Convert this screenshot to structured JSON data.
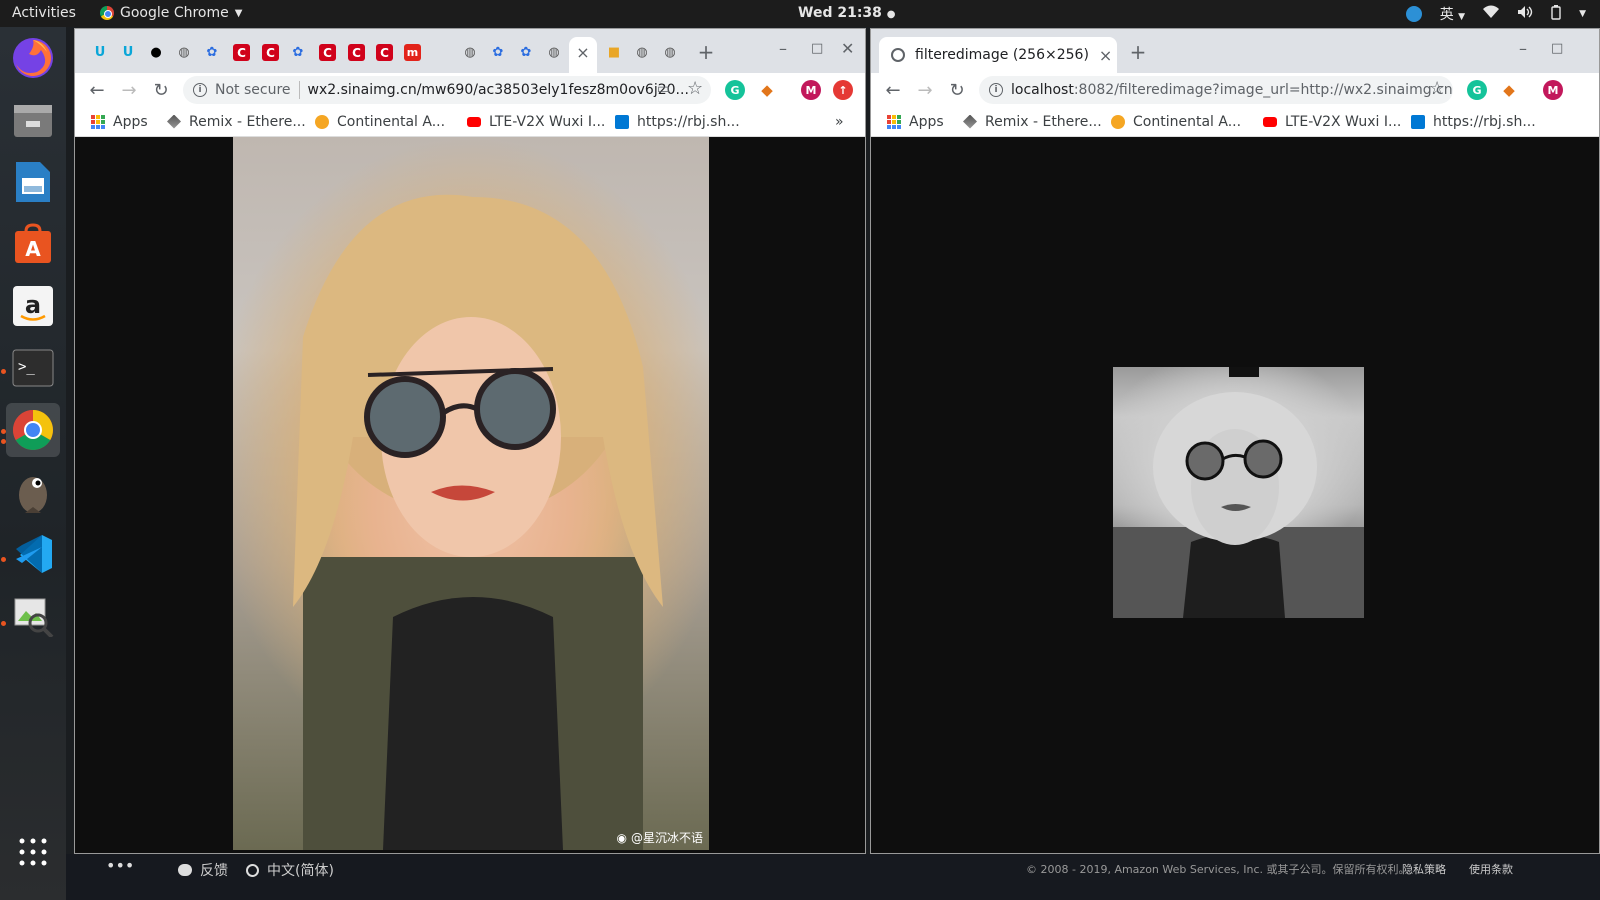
{
  "topbar": {
    "activities": "Activities",
    "app_name": "Google Chrome",
    "clock": "Wed 21:38",
    "input_method": "英"
  },
  "dock": {
    "items": [
      "firefox-icon",
      "files-icon",
      "writer-icon",
      "software-center-icon",
      "amazon-icon",
      "terminal-icon",
      "chrome-icon",
      "gimp-icon",
      "vscode-icon",
      "image-viewer-icon"
    ],
    "show_apps": "show-apps-icon"
  },
  "left_window": {
    "tab_close": "×",
    "new_tab": "+",
    "not_secure": "Not secure",
    "url": "wx2.sinaimg.cn/mw690/ac38503ely1fesz8m0ov6j20...",
    "bookmarks": [
      "Apps",
      "Remix - Ethere...",
      "Continental A...",
      "LTE-V2X Wuxi I...",
      "https://rbj.sh..."
    ],
    "more_bookmarks": "»",
    "watermark": "@星沉冰不语"
  },
  "right_window": {
    "tab_title": "filteredimage (256×256)",
    "tab_close": "×",
    "new_tab": "+",
    "url_host": "localhost",
    "url_rest": ":8082/filteredimage?image_url=http://wx2.sinaimg.cn...",
    "bookmarks": [
      "Apps",
      "Remix - Ethere...",
      "Continental A...",
      "LTE-V2X Wuxi I...",
      "https://rbj.sh..."
    ]
  },
  "bottom": {
    "feedback": "反馈",
    "language": "中文(简体)",
    "copyright": "© 2008 - 2019, Amazon Web Services, Inc. 或其子公司。保留所有权利。",
    "privacy": "隐私策略",
    "terms": "使用条款"
  },
  "colors": {
    "topbar": "#1c1c1c",
    "tabstrip": "#dee1e6",
    "viewport": "#0e0e0e",
    "ubuntu_accent": "#e95420"
  }
}
